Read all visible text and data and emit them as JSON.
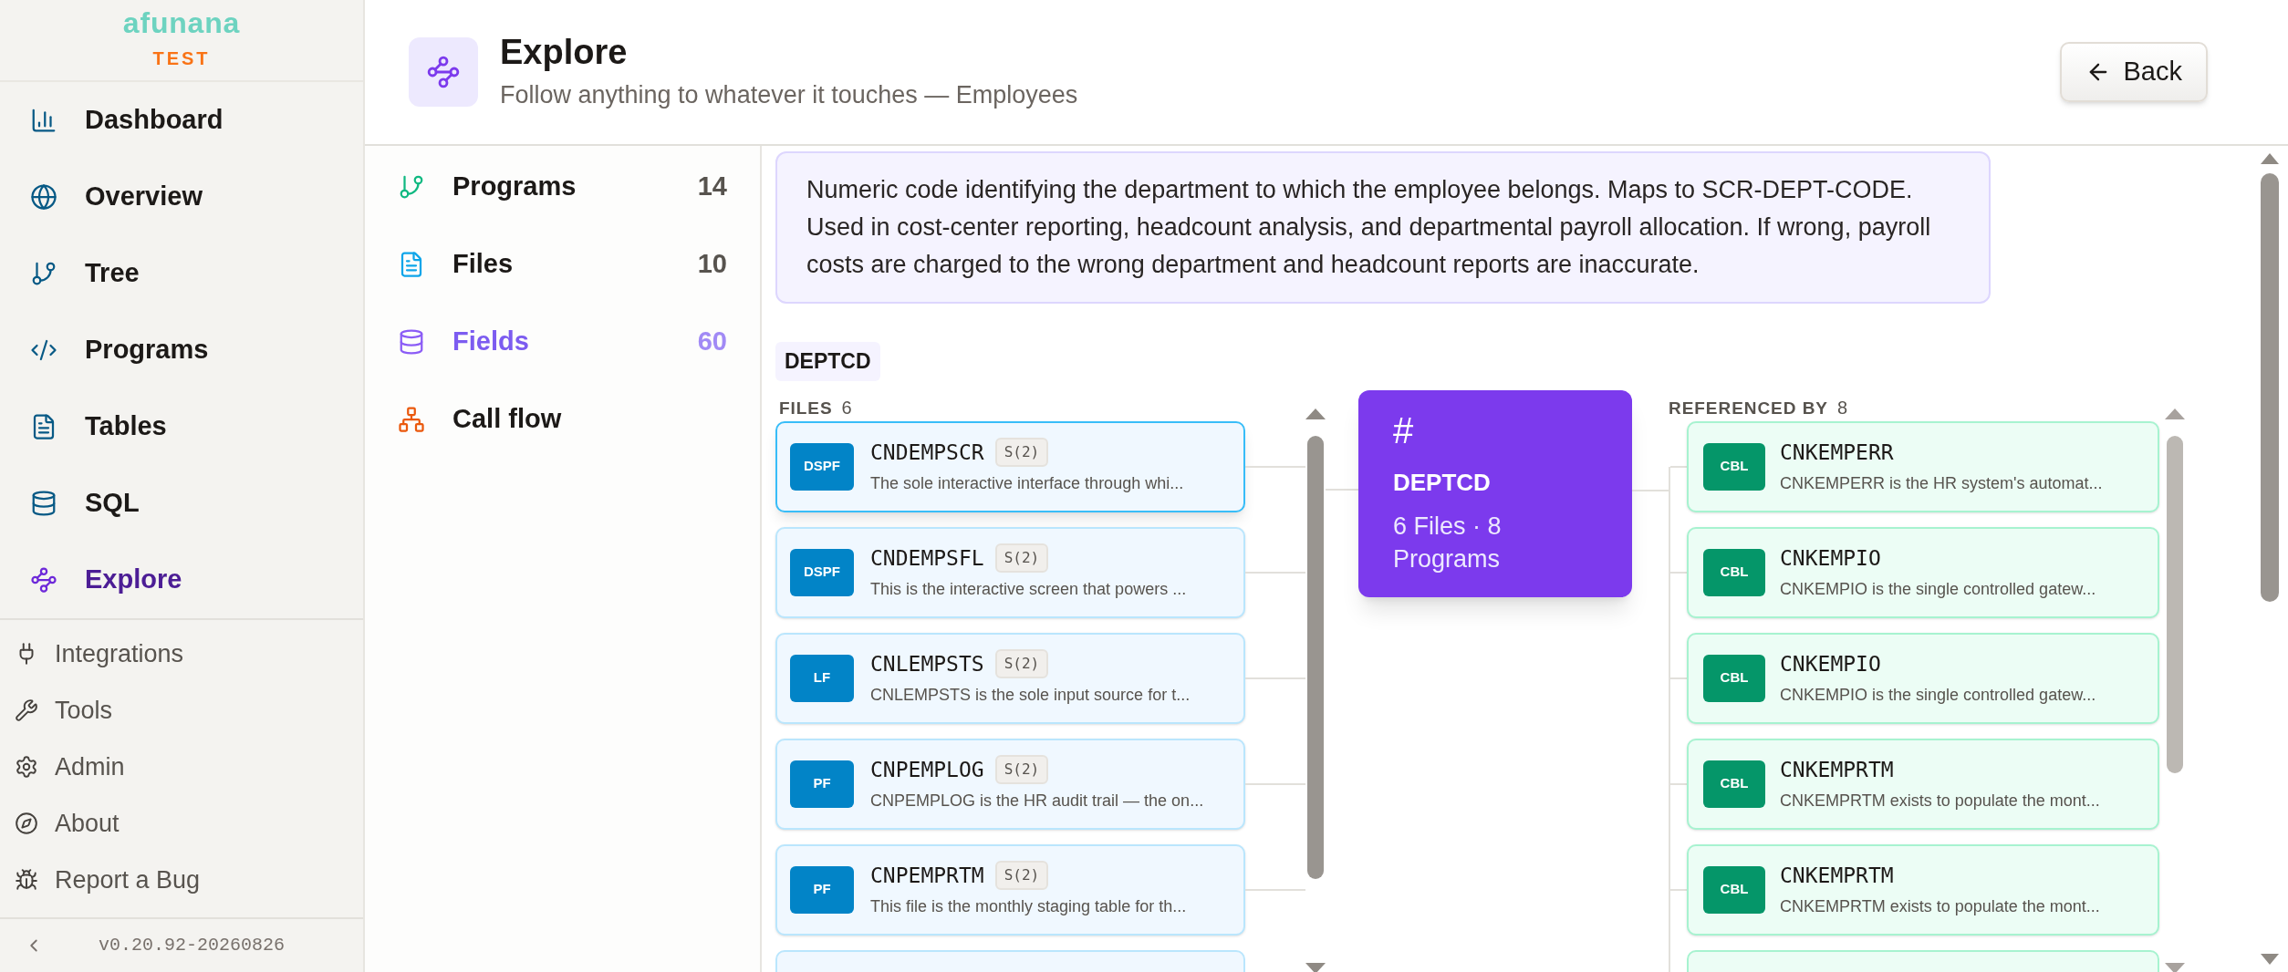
{
  "brand": {
    "name": "afunana",
    "env": "TEST"
  },
  "nav": [
    {
      "label": "Dashboard",
      "kind": "chart",
      "selected": false
    },
    {
      "label": "Overview",
      "kind": "globe",
      "selected": false
    },
    {
      "label": "Tree",
      "kind": "branch",
      "selected": false
    },
    {
      "label": "Programs",
      "kind": "code",
      "selected": false
    },
    {
      "label": "Tables",
      "kind": "file",
      "selected": false
    },
    {
      "label": "SQL",
      "kind": "database",
      "selected": false
    },
    {
      "label": "Explore",
      "kind": "waypoints",
      "selected": true
    }
  ],
  "secondary_nav": [
    {
      "label": "Integrations",
      "kind": "plug"
    },
    {
      "label": "Tools",
      "kind": "wrench"
    },
    {
      "label": "Admin",
      "kind": "gear"
    },
    {
      "label": "About",
      "kind": "compass"
    },
    {
      "label": "Report a Bug",
      "kind": "bug"
    }
  ],
  "version": "v0.20.92-20260826",
  "header": {
    "title": "Explore",
    "subtitle": "Follow anything to whatever it touches — Employees",
    "back": "Back"
  },
  "categories": [
    {
      "label": "Programs",
      "count": "14",
      "kind": "branch",
      "selected": false
    },
    {
      "label": "Files",
      "count": "10",
      "kind": "file",
      "selected": false
    },
    {
      "label": "Fields",
      "count": "60",
      "kind": "database",
      "selected": true
    },
    {
      "label": "Call flow",
      "kind": "network",
      "selected": false
    }
  ],
  "description": "Numeric code identifying the department to which the employee belongs. Maps to SCR-DEPT-CODE. Used in cost-center reporting, headcount analysis, and departmental payroll allocation. If wrong, payroll costs are charged to the wrong department and headcount reports are inaccurate.",
  "field_tag": "DEPTCD",
  "files": {
    "label": "FILES",
    "count": "6",
    "items": [
      {
        "type": "DSPF",
        "name": "CNDEMPSCR",
        "tag": "S(2)",
        "desc": "The sole interactive interface through whi...",
        "selected": true
      },
      {
        "type": "DSPF",
        "name": "CNDEMPSFL",
        "tag": "S(2)",
        "desc": "This is the interactive screen that powers ...",
        "selected": false
      },
      {
        "type": "LF",
        "name": "CNLEMPSTS",
        "tag": "S(2)",
        "desc": "CNLEMPSTS is the sole input source for t...",
        "selected": false
      },
      {
        "type": "PF",
        "name": "CNPEMPLOG",
        "tag": "S(2)",
        "desc": "CNPEMPLOG is the HR audit trail — the on...",
        "selected": false
      },
      {
        "type": "PF",
        "name": "CNPEMPRTM",
        "tag": "S(2)",
        "desc": "This file is the monthly staging table for th...",
        "selected": false
      }
    ]
  },
  "center": {
    "symbol": "#",
    "name": "DEPTCD",
    "summary": "6 Files · 8 Programs"
  },
  "references": {
    "label": "REFERENCED BY",
    "count": "8",
    "items": [
      {
        "type": "CBL",
        "name": "CNKEMPERR",
        "desc": "CNKEMPERR is the HR system's automat..."
      },
      {
        "type": "CBL",
        "name": "CNKEMPIO",
        "desc": "CNKEMPIO is the single controlled gatew..."
      },
      {
        "type": "CBL",
        "name": "CNKEMPIO",
        "desc": "CNKEMPIO is the single controlled gatew..."
      },
      {
        "type": "CBL",
        "name": "CNKEMPRTM",
        "desc": "CNKEMPRTM exists to populate the mont..."
      },
      {
        "type": "CBL",
        "name": "CNKEMPRTM",
        "desc": "CNKEMPRTM exists to populate the mont..."
      }
    ]
  }
}
